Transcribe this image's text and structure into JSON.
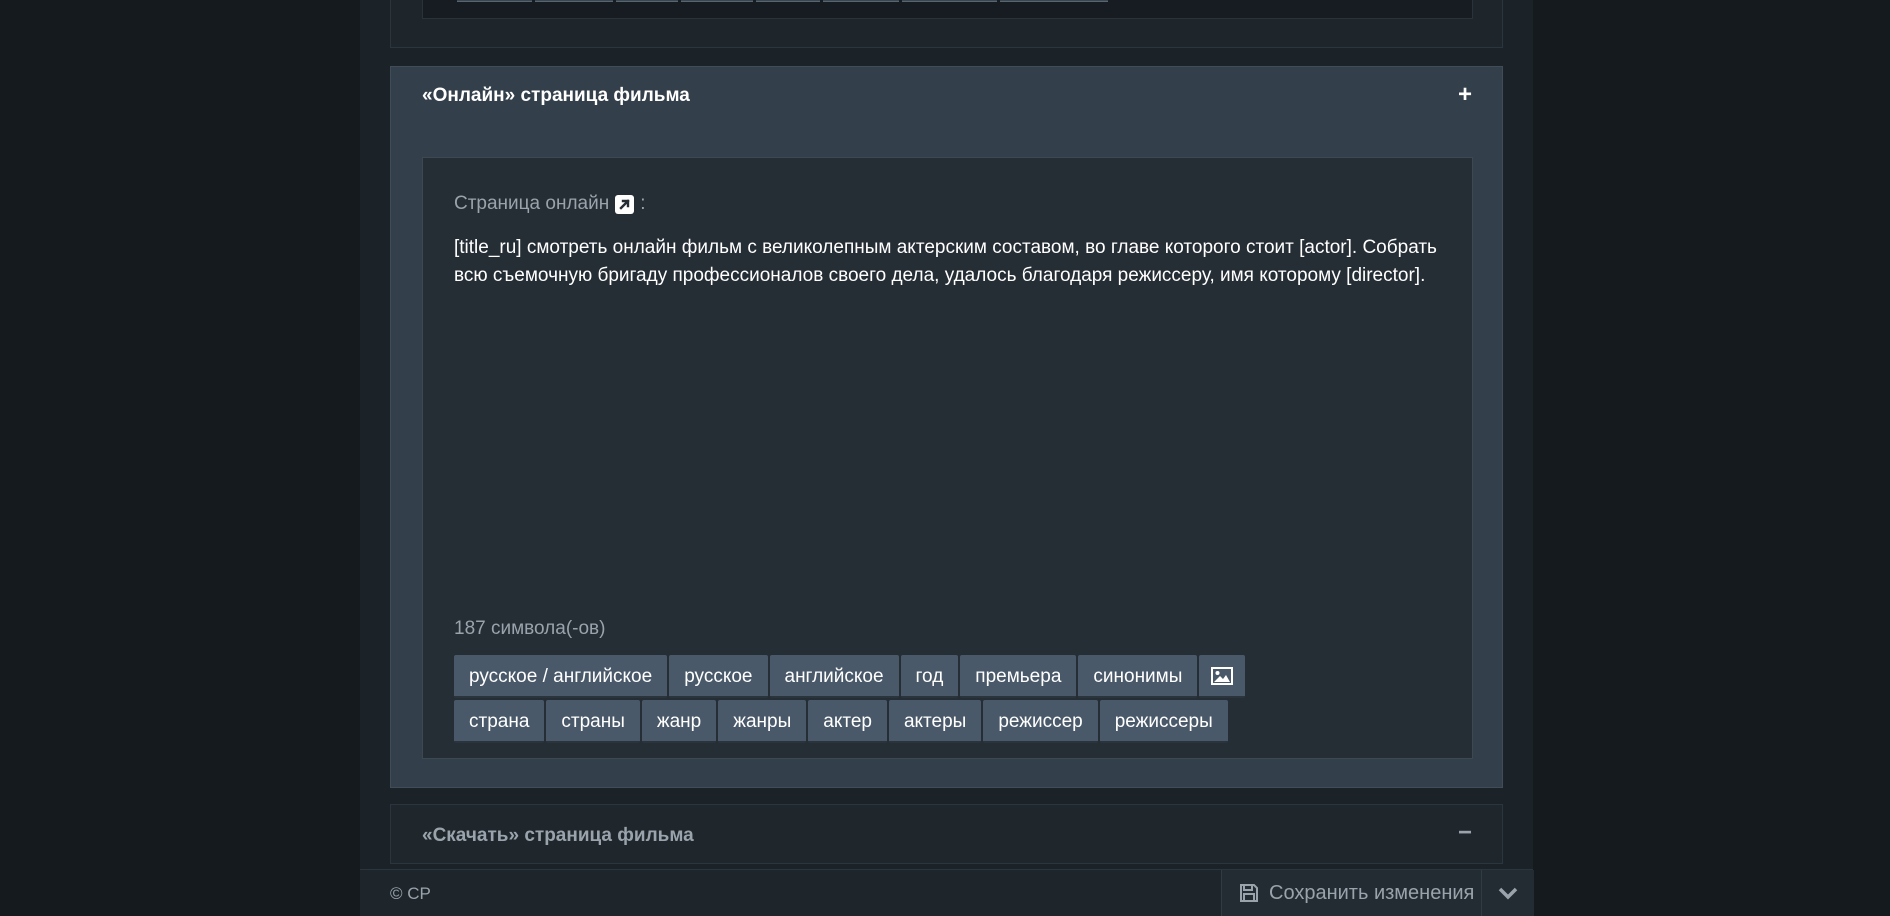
{
  "online_section": {
    "title": "«Онлайн» страница фильма",
    "toggle": "+",
    "field_label": "Страница онлайн",
    "field_label_suffix": ":",
    "field_value": "[title_ru] смотреть онлайн фильм с великолепным актерским составом, во главе которого стоит [actor]. Собрать всю съемочную бригаду профессионалов своего дела, удалось благодаря режиссеру, имя которому [director].",
    "char_count": "187 символа(-ов)",
    "tags_row1": [
      "русское / английское",
      "русское",
      "английское",
      "год",
      "премьера",
      "синонимы"
    ],
    "image_tag_icon": "image-icon",
    "tags_row2": [
      "страна",
      "страны",
      "жанр",
      "жанры",
      "актер",
      "актеры",
      "режиссер",
      "режиссеры"
    ]
  },
  "download_section": {
    "title": "«Скачать» страница фильма",
    "toggle": "−"
  },
  "footer": {
    "copyright": "© CP",
    "save_label": "Сохранить изменения",
    "save_icon": "floppy-disk-icon",
    "chevron_icon": "chevron-down-icon"
  }
}
